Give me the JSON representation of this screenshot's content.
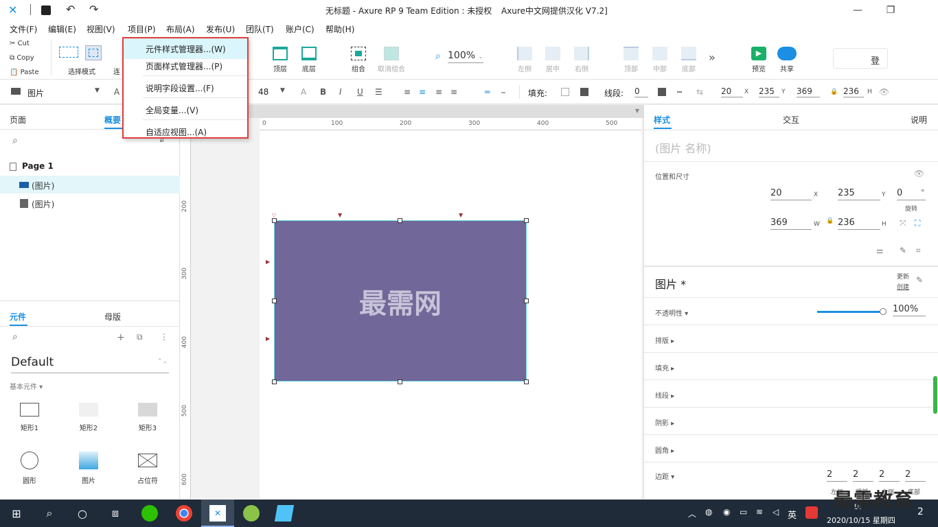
{
  "app": {
    "title": "无标题 - Axure RP 9 Team Edition : 未授权",
    "title_extra": "Axure中文网提供汉化 V7.2]",
    "logo_icon": "axure-logo-icon"
  },
  "menubar": {
    "items": [
      "文件(F)",
      "编辑(E)",
      "视图(V)",
      "项目(P)",
      "布局(A)",
      "发布(U)",
      "团队(T)",
      "账户(C)",
      "帮助(H)"
    ]
  },
  "clipboard": {
    "cut": "Cut",
    "copy": "Copy",
    "paste": "Paste"
  },
  "toolbar": {
    "select_mode": "选择模式",
    "partial": "连",
    "top_layer": "顶层",
    "bottom_layer": "底层",
    "group": "组合",
    "ungroup": "取消组合",
    "zoom": "100%",
    "align_left": "左侧",
    "align_center": "居中",
    "align_right": "右侧",
    "align_top": "顶部",
    "align_middle": "中部",
    "align_bottom": "底部",
    "preview": "预览",
    "share": "共享",
    "login": "登"
  },
  "format": {
    "widget_type": "图片",
    "font_size": "48",
    "fill_label": "填充:",
    "stroke_label": "线段:",
    "stroke_value": "0",
    "x": "20",
    "y": "235",
    "w": "369",
    "h": "236",
    "x_label": "X",
    "y_label": "Y",
    "w_label": "W",
    "h_label": "H"
  },
  "dropdown": {
    "items": [
      "元件样式管理器...(W)",
      "页面样式管理器...(P)",
      "说明字段设置...(F)",
      "全局变量...(V)",
      "自适应视图...(A)"
    ]
  },
  "pages_panel": {
    "tab_pages": "页面",
    "tab_outline": "概要",
    "page_name": "Page 1",
    "items": [
      "(图片)",
      "(图片)"
    ]
  },
  "widgets_panel": {
    "tab_widgets": "元件",
    "tab_masters": "母版",
    "library": "Default",
    "category": "基本元件 ▾",
    "items": [
      "矩形1",
      "矩形2",
      "矩形3",
      "圆形",
      "图片",
      "占位符"
    ]
  },
  "canvas": {
    "ruler_ticks": [
      "0",
      "100",
      "200",
      "300",
      "400",
      "500"
    ],
    "ruler_left_ticks": [
      "200",
      "300",
      "400",
      "500",
      "600"
    ],
    "image_text": "最需网"
  },
  "inspector": {
    "tab_style": "样式",
    "tab_interaction": "交互",
    "tab_notes": "说明",
    "name_placeholder": "(图片 名称)",
    "pos_size_label": "位置和尺寸",
    "x": "20",
    "y": "235",
    "rotation": "0",
    "rotation_unit": "°",
    "rotation_label": "旋转",
    "w": "369",
    "h": "236",
    "style_name": "图片 *",
    "update": "更新",
    "create": "创建",
    "opacity_label": "不透明性 ▾",
    "opacity_value": "100%",
    "opacity_fraction": 1.0,
    "sections": [
      "排版 ▸",
      "填充 ▸",
      "线段 ▸",
      "阴影 ▸",
      "圆角 ▸"
    ],
    "padding_label": "边距 ▾",
    "padding": [
      "2",
      "2",
      "2",
      "2"
    ],
    "padding_labels": [
      "左侧",
      "顶部",
      "右侧",
      "底部"
    ]
  },
  "taskbar": {
    "time": "9:",
    "date": "2020/10/15 星期四",
    "ime": "英",
    "notification_count": "2",
    "watermark": "最需教育"
  },
  "colors": {
    "accent": "#1a8fe3",
    "image_fill": "#726799",
    "dropdown_border": "#e03c3c",
    "preview_green": "#19b06a"
  }
}
